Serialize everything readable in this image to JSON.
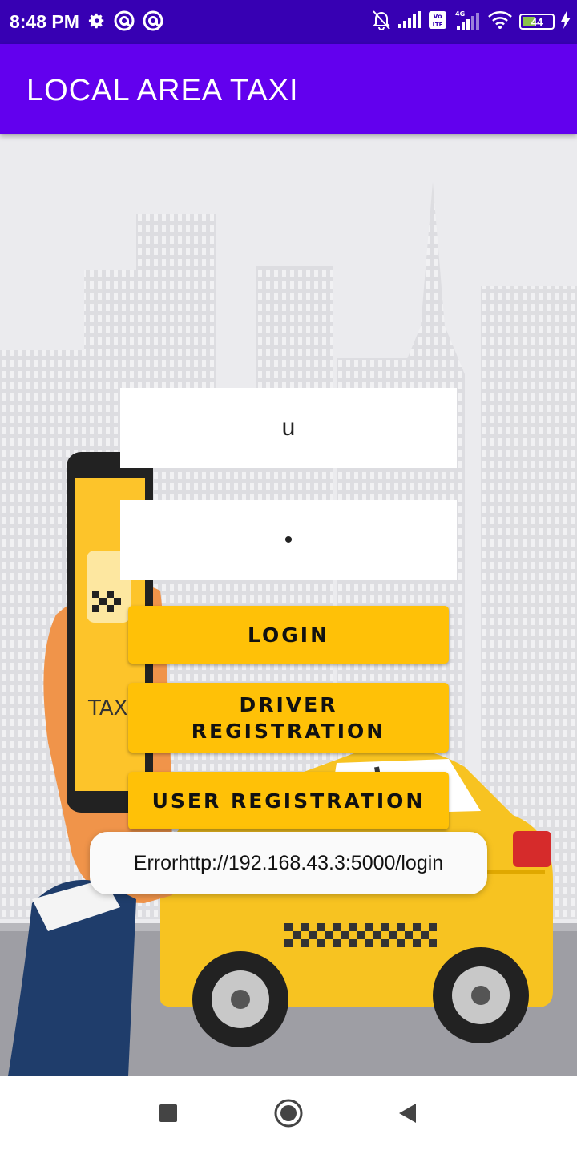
{
  "status_bar": {
    "time": "8:48 PM",
    "left_icons": [
      "gear-icon",
      "at-sign-icon",
      "at-sign-icon"
    ],
    "right_icons": [
      "bell-muted-icon",
      "signal-icon",
      "volte-icon",
      "signal-4g-icon",
      "wifi-icon",
      "battery-icon",
      "charging-icon"
    ],
    "volte_label": "Vo LTE",
    "network_label": "4G",
    "battery_level": "44"
  },
  "app_bar": {
    "title": "LOCAL AREA TAXI"
  },
  "form": {
    "username_value": "u",
    "password_value": "•"
  },
  "buttons": {
    "login": "LOGIN",
    "driver_registration_line1": "DRIVER",
    "driver_registration_line2": "REGISTRATION",
    "user_registration": "USER REGISTRATION"
  },
  "toast": {
    "message": "Errorhttp://192.168.43.3:5000/login"
  },
  "background": {
    "taxi_label": "TAXI"
  },
  "nav_bar": {
    "icons": [
      "square-recents-icon",
      "circle-home-icon",
      "triangle-back-icon"
    ]
  },
  "colors": {
    "status_bar": "#3700b3",
    "app_bar": "#6200ee",
    "button": "#ffc107"
  }
}
